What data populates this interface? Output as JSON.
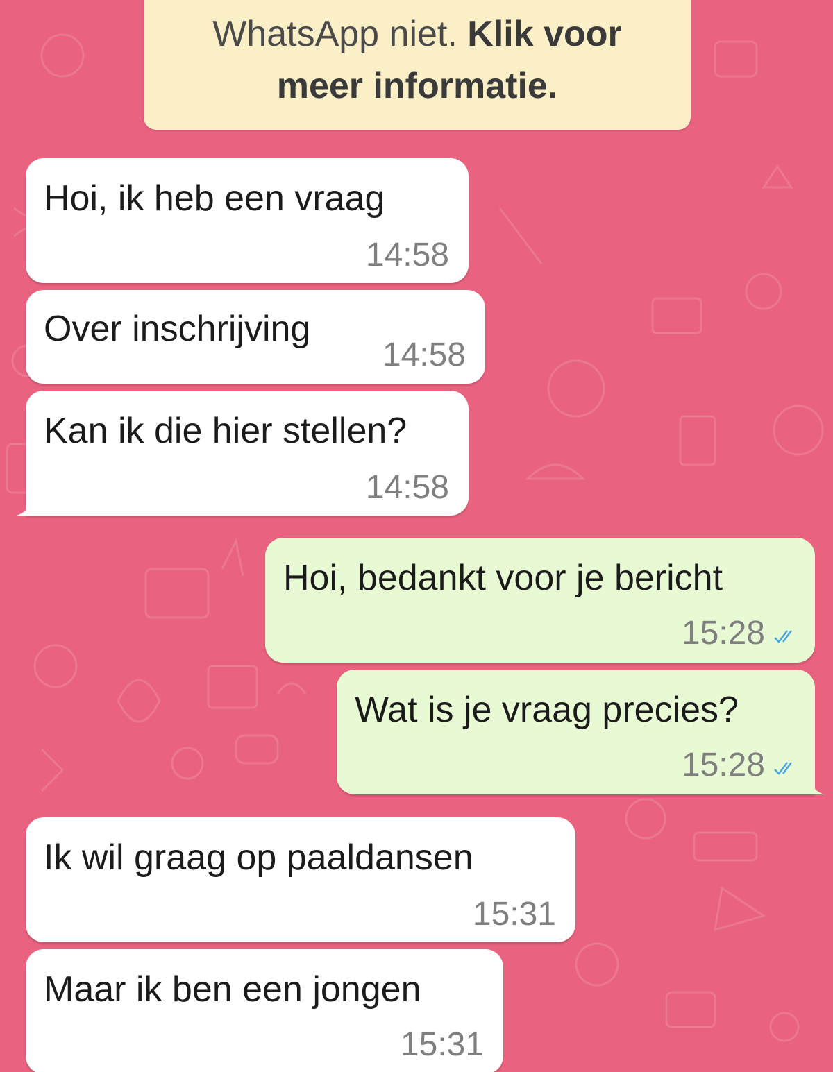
{
  "notice": {
    "line1": "",
    "line2_plain": "WhatsApp niet. ",
    "line2_bold": "Klik voor",
    "line3_bold": "meer informatie."
  },
  "messages": [
    {
      "direction": "incoming",
      "text": "Hoi, ik heb een vraag",
      "time": "14:58"
    },
    {
      "direction": "incoming",
      "text": "Over inschrijving",
      "time": "14:58"
    },
    {
      "direction": "incoming",
      "text": "Kan ik die hier stellen?",
      "time": "14:58"
    },
    {
      "direction": "outgoing",
      "text": "Hoi, bedankt voor je bericht",
      "time": "15:28",
      "status": "read"
    },
    {
      "direction": "outgoing",
      "text": "Wat is je vraag precies?",
      "time": "15:28",
      "status": "read"
    },
    {
      "direction": "incoming",
      "text": "Ik wil graag op paaldansen",
      "time": "15:31"
    },
    {
      "direction": "incoming",
      "text": "Maar ik ben een jongen",
      "time": "15:31"
    }
  ],
  "colors": {
    "wallpaper": "#e96380",
    "incoming_bubble": "#ffffff",
    "outgoing_bubble": "#e7fad3",
    "notice_bg": "#faefc6",
    "read_tick": "#4fa6e6"
  },
  "icons": {
    "read_status": "double-check-icon"
  }
}
